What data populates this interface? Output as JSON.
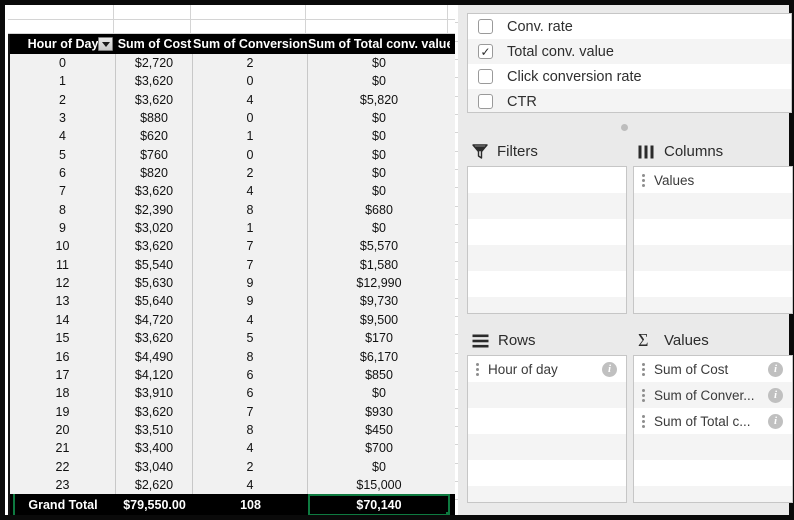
{
  "spreadsheet": {
    "headers": [
      "Hour of Day",
      "Sum of Cost",
      "Sum of Conversions",
      "Sum of Total conv. value"
    ],
    "filter_icon": "filter-dropdown-arrow",
    "rows": [
      [
        "0",
        "$2,720",
        "2",
        "$0"
      ],
      [
        "1",
        "$3,620",
        "0",
        "$0"
      ],
      [
        "2",
        "$3,620",
        "4",
        "$5,820"
      ],
      [
        "3",
        "$880",
        "0",
        "$0"
      ],
      [
        "4",
        "$620",
        "1",
        "$0"
      ],
      [
        "5",
        "$760",
        "0",
        "$0"
      ],
      [
        "6",
        "$820",
        "2",
        "$0"
      ],
      [
        "7",
        "$3,620",
        "4",
        "$0"
      ],
      [
        "8",
        "$2,390",
        "8",
        "$680"
      ],
      [
        "9",
        "$3,020",
        "1",
        "$0"
      ],
      [
        "10",
        "$3,620",
        "7",
        "$5,570"
      ],
      [
        "11",
        "$5,540",
        "7",
        "$1,580"
      ],
      [
        "12",
        "$5,630",
        "9",
        "$12,990"
      ],
      [
        "13",
        "$5,640",
        "9",
        "$9,730"
      ],
      [
        "14",
        "$4,720",
        "4",
        "$9,500"
      ],
      [
        "15",
        "$3,620",
        "5",
        "$170"
      ],
      [
        "16",
        "$4,490",
        "8",
        "$6,170"
      ],
      [
        "17",
        "$4,120",
        "6",
        "$850"
      ],
      [
        "18",
        "$3,910",
        "6",
        "$0"
      ],
      [
        "19",
        "$3,620",
        "7",
        "$930"
      ],
      [
        "20",
        "$3,510",
        "8",
        "$450"
      ],
      [
        "21",
        "$3,400",
        "4",
        "$700"
      ],
      [
        "22",
        "$3,040",
        "2",
        "$0"
      ],
      [
        "23",
        "$2,620",
        "4",
        "$15,000"
      ]
    ],
    "grand_total": [
      "Grand Total",
      "$79,550.00",
      "108",
      "$70,140"
    ],
    "selected_cell": "$70,140",
    "selection_color": "#0e7a40"
  },
  "pane": {
    "field_list": [
      {
        "label": "Conv. rate",
        "checked": false
      },
      {
        "label": "Total conv. value",
        "checked": true
      },
      {
        "label": "Click conversion rate",
        "checked": false
      },
      {
        "label": "CTR",
        "checked": false
      }
    ],
    "checked_glyph": "✓",
    "zones": {
      "filters": {
        "title": "Filters",
        "icon": "funnel-icon",
        "items": []
      },
      "columns": {
        "title": "Columns",
        "icon": "columns-icon",
        "items": [
          "Values"
        ]
      },
      "rows": {
        "title": "Rows",
        "icon": "rows-icon",
        "items": [
          "Hour of day"
        ]
      },
      "values": {
        "title": "Values",
        "icon": "sigma-icon",
        "items": [
          "Sum of Cost",
          "Sum of Conver...",
          "Sum of Total c..."
        ]
      }
    },
    "info_glyph": "i"
  }
}
